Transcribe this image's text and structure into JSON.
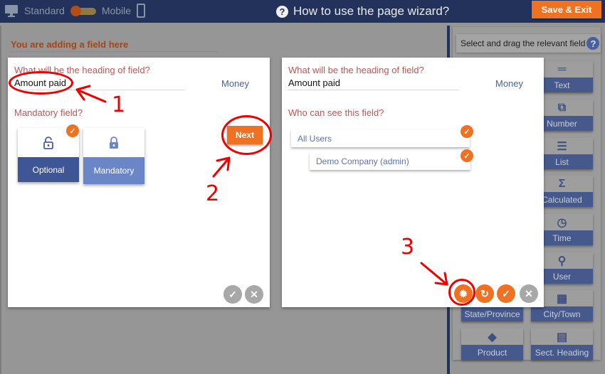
{
  "topbar": {
    "standard_label": "Standard",
    "mobile_label": "Mobile",
    "title": "How to use the page wizard?",
    "help_glyph": "?",
    "save_exit_label": "Save & Exit",
    "layout_toggle": "standard"
  },
  "main": {
    "section_title": "You are adding a field here",
    "step1": {
      "heading_question": "What will be the heading of field?",
      "heading_value": "Amount paid",
      "field_type": "Money",
      "mandatory_question": "Mandatory field?",
      "options": [
        {
          "label": "Optional",
          "icon": "unlocked-icon",
          "selected": true
        },
        {
          "label": "Mandatory",
          "icon": "locked-icon",
          "selected": false
        }
      ],
      "next_label": "Next"
    },
    "step2": {
      "heading_question": "What will be the heading of field?",
      "heading_value": "Amount paid",
      "field_type": "Money",
      "visibility_question": "Who can see this field?",
      "users": [
        {
          "label": "All Users",
          "checked": true
        },
        {
          "label": "Demo Company (admin)",
          "checked": true
        }
      ]
    }
  },
  "annotations": [
    "1",
    "2",
    "3"
  ],
  "sidebar": {
    "header": "Select and drag the relevant field",
    "help_glyph": "?",
    "tiles": [
      {
        "label": "Text",
        "icon": "text-icon",
        "glyph": "═"
      },
      {
        "label": "Number",
        "icon": "number-icon",
        "glyph": "⧉"
      },
      {
        "label": "List",
        "icon": "list-icon",
        "glyph": "☰"
      },
      {
        "label": "Calculated",
        "icon": "sigma-icon",
        "glyph": "Σ"
      },
      {
        "label": "Time",
        "icon": "clock-icon",
        "glyph": "◷"
      },
      {
        "label": "User",
        "icon": "user-icon",
        "glyph": "⚲"
      },
      {
        "label": "State/Province",
        "icon": "map-icon",
        "glyph": ""
      },
      {
        "label": "City/Town",
        "icon": "building-icon",
        "glyph": "▦"
      },
      {
        "label": "Product",
        "icon": "tag-icon",
        "glyph": "◆"
      },
      {
        "label": "Sect. Heading",
        "icon": "section-heading-icon",
        "glyph": "▤"
      }
    ]
  },
  "glyphs": {
    "check": "✓",
    "close": "✕",
    "undo": "↻",
    "gear": "✹"
  }
}
